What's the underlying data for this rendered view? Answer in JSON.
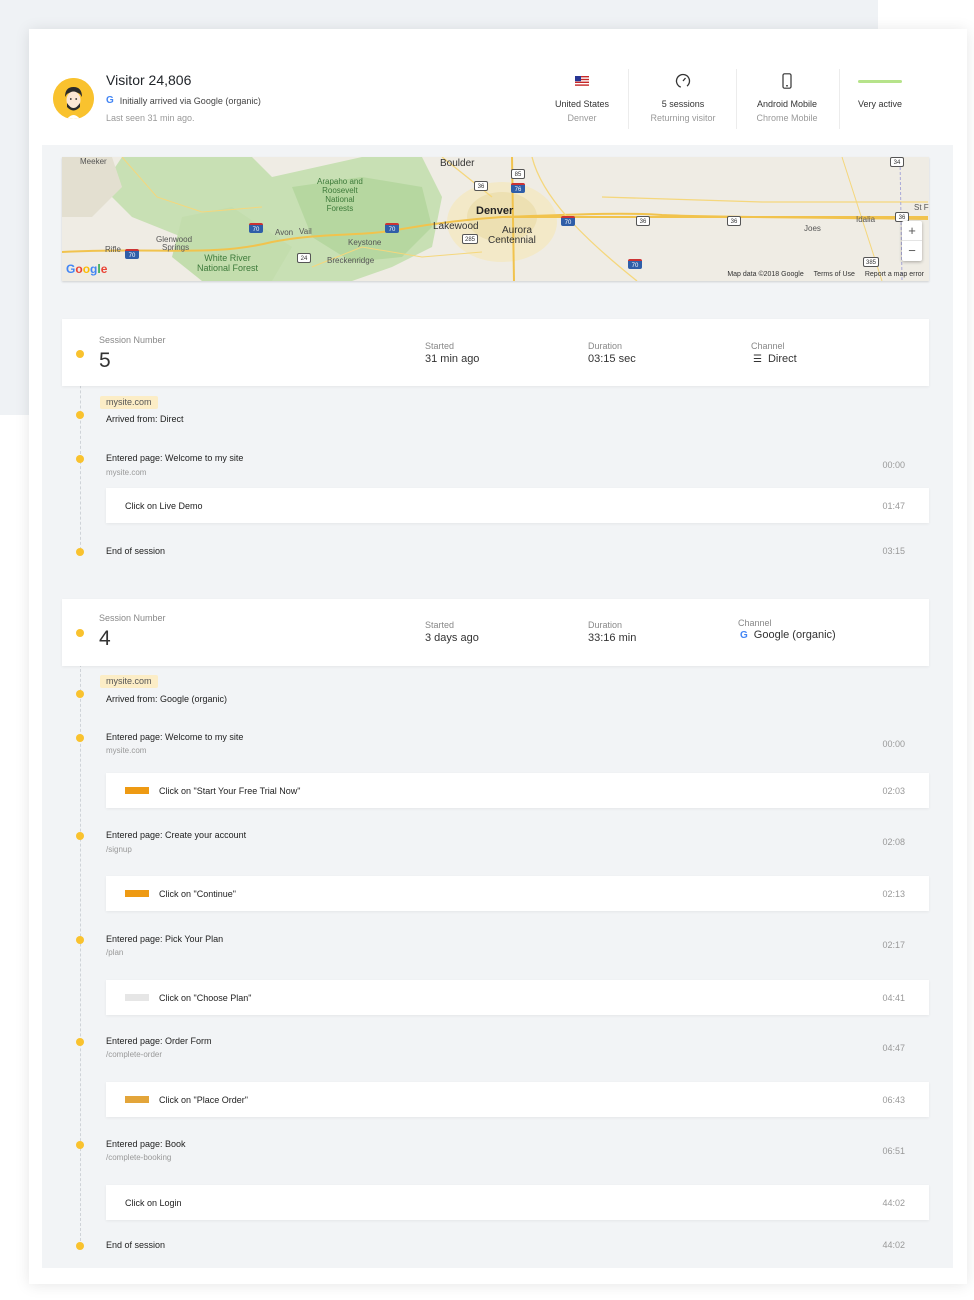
{
  "visitor": {
    "title": "Visitor 24,806",
    "origin": "Initially arrived via Google (organic)",
    "last_seen": "Last seen 31 min ago.",
    "stats": [
      {
        "icon": "us-flag-icon",
        "line1": "United States",
        "line2": "Denver"
      },
      {
        "icon": "speedometer-icon",
        "line1": "5 sessions",
        "line2": "Returning visitor"
      },
      {
        "icon": "mobile-phone-icon",
        "line1": "Android Mobile",
        "line2": "Chrome Mobile"
      },
      {
        "icon": "activity-bar-icon",
        "line1": "Very active",
        "line2": ""
      }
    ],
    "activity_color": "#b6e38a"
  },
  "map": {
    "labels": {
      "meeker": "Meeker",
      "boulder": "Boulder",
      "arapaho": "Arapaho and",
      "roosevelt": "Roosevelt",
      "national": "National",
      "forests": "Forests",
      "denver": "Denver",
      "lakewood": "Lakewood",
      "aurora": "Aurora",
      "centennial": "Centennial",
      "glenwood1": "Glenwood",
      "glenwood2": "Springs",
      "rifle": "Rifle",
      "avon": "Avon",
      "vail": "Vail",
      "keystone": "Keystone",
      "breckenridge": "Breckenridge",
      "white_river1": "White River",
      "white_river2": "National Forest",
      "joes": "Joes",
      "idalia": "Idalia",
      "st_f": "St F"
    },
    "shields": [
      "85",
      "36",
      "76",
      "70",
      "70",
      "70",
      "36",
      "36",
      "34",
      "36",
      "24",
      "285",
      "70",
      "385",
      "70"
    ],
    "google": "Google",
    "credits": {
      "data": "Map data ©2018 Google",
      "terms": "Terms of Use",
      "report": "Report a map error"
    },
    "zoom_in": "+",
    "zoom_out": "−"
  },
  "session5": {
    "number_label": "Session Number",
    "number": "5",
    "started_label": "Started",
    "started": "31 min ago",
    "duration_label": "Duration",
    "duration": "03:15 sec",
    "channel_label": "Channel",
    "channel": "Direct",
    "site": "mysite.com",
    "arrived": "Arrived from: Direct",
    "events": [
      {
        "title": "Entered page:  Welcome to my site",
        "sub": "mysite.com",
        "time": "00:00"
      },
      {
        "click": "Click on  Live Demo",
        "time": "01:47"
      },
      {
        "title": "End of session",
        "time": "03:15"
      }
    ]
  },
  "session4": {
    "number_label": "Session Number",
    "number": "4",
    "started_label": "Started",
    "started": "3 days ago",
    "duration_label": "Duration",
    "duration": "33:16 min",
    "channel_label": "Channel",
    "channel": "Google (organic)",
    "site": "mysite.com",
    "arrived": "Arrived from: Google (organic)",
    "events": [
      {
        "title": "Entered page:  Welcome to my site",
        "sub": "mysite.com",
        "time": "00:00"
      },
      {
        "click": "Click on \"Start Your Free Trial Now\"",
        "time": "02:03",
        "swatch": "#ee9a13"
      },
      {
        "title": "Entered page:  Create your account",
        "sub": "/signup",
        "time": "02:08"
      },
      {
        "click": "Click on \"Continue\"",
        "time": "02:13",
        "swatch": "#ee9a13"
      },
      {
        "title": "Entered page: Pick Your Plan",
        "sub": "/plan",
        "time": "02:17"
      },
      {
        "click": "Click on \"Choose Plan\"",
        "time": "04:41",
        "swatch": "#e6e6e6"
      },
      {
        "title": "Entered page: Order Form",
        "sub": "/complete-order",
        "time": "04:47"
      },
      {
        "click": "Click on \"Place Order\"",
        "time": "06:43",
        "swatch": "#e3a53a"
      },
      {
        "title": "Entered page:  Book",
        "sub": "/complete-booking",
        "time": "06:51"
      },
      {
        "click": "Click on  Login",
        "time": "44:02"
      },
      {
        "title": "End of session",
        "time": "44:02"
      }
    ]
  },
  "colors": {
    "accent": "#f9c22e",
    "tag_bg": "#fcedc6",
    "orange": "#ee9a13"
  }
}
